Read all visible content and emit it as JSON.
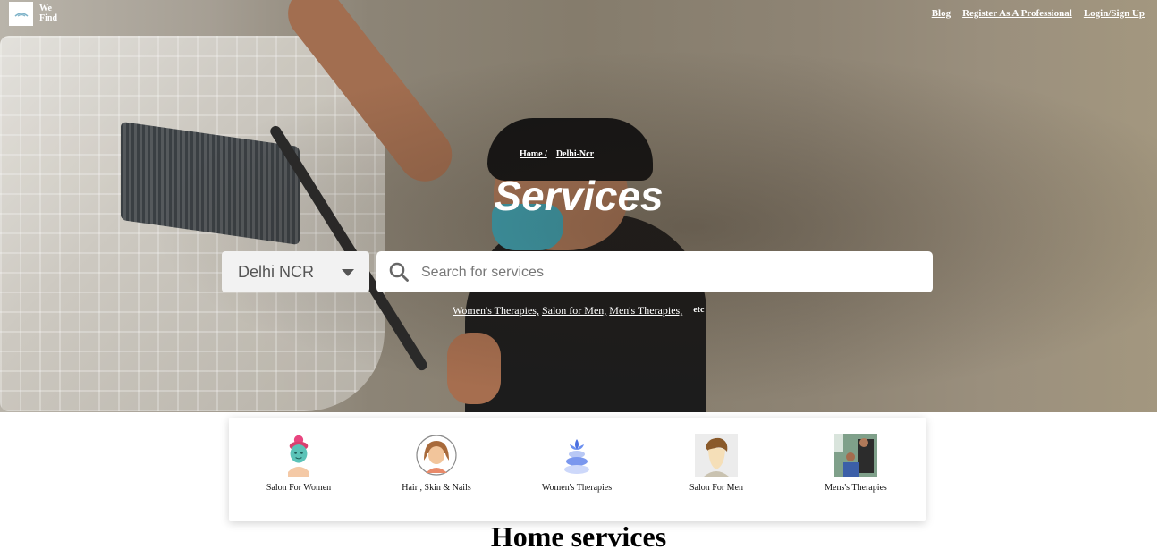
{
  "logo": {
    "text_line1": "We",
    "text_line2": "Find"
  },
  "nav": {
    "blog": "Blog",
    "register": "Register As A Professional",
    "login": "Login/Sign Up"
  },
  "breadcrumb": {
    "home": "Home /",
    "current": "Delhi-Ncr"
  },
  "hero": {
    "title": "Services"
  },
  "search": {
    "city": "Delhi NCR",
    "placeholder": "Search for services"
  },
  "suggestions": {
    "items": [
      "Women's Therapies,",
      "Salon for Men,",
      "Men's Therapies,"
    ],
    "etc": "etc"
  },
  "categories": [
    {
      "label": "Salon For Women",
      "icon": "woman-facial-icon"
    },
    {
      "label": "Hair , Skin & Nails",
      "icon": "woman-avatar-icon"
    },
    {
      "label": "Women's Therapies",
      "icon": "lotus-stones-icon"
    },
    {
      "label": "Salon For Men",
      "icon": "man-avatar-icon"
    },
    {
      "label": "Mens's Therapies",
      "icon": "barber-photo-icon"
    }
  ],
  "section": {
    "title": "Home services"
  },
  "colors": {
    "text_on_hero": "#ffffff",
    "select_bg": "#f2f2f2",
    "card_bg": "#ffffff"
  }
}
